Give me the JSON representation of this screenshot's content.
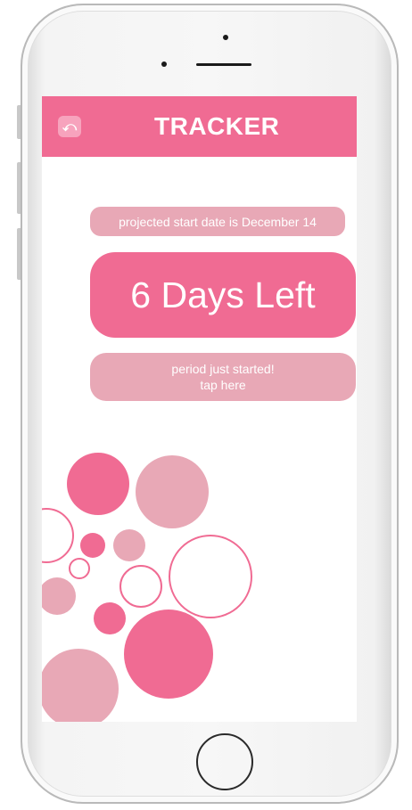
{
  "header": {
    "back_icon": "undo-icon",
    "back_glyph": "⤺",
    "title": "TRACKER"
  },
  "tracker": {
    "projected_text": "projected start date is December 14",
    "days_left_text": "6 Days Left",
    "period_line1": "period just started!",
    "period_line2": "tap here"
  },
  "colors": {
    "primary_pink": "#f06b93",
    "muted_pink": "#e8a8b6",
    "screen_bg": "#ffffff"
  },
  "device": {
    "type": "phone-mockup"
  }
}
